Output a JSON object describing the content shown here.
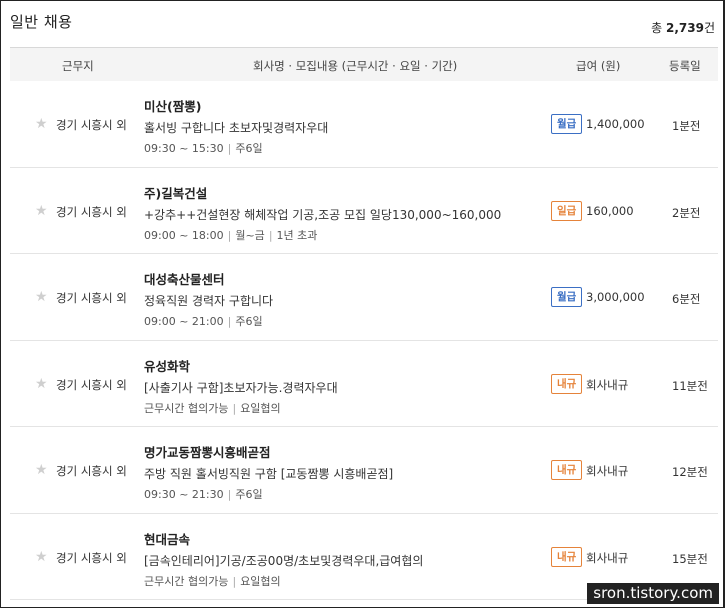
{
  "header": {
    "title": "일반 채용",
    "total_prefix": "총 ",
    "total_count": "2,739",
    "total_suffix": "건"
  },
  "table_header": {
    "location": "근무지",
    "company": "회사명 · 모집내용 (근무시간 · 요일 · 기간)",
    "pay": "급여 (원)",
    "posted": "등록일"
  },
  "rows": [
    {
      "location": "경기 시흥시 외",
      "company": "미산(짬뽕)",
      "desc": "홀서빙 구합니다 초보자및경력자우대",
      "meta": [
        "09:30 ~ 15:30",
        "주6일"
      ],
      "pay_type": "월급",
      "pay_color": "blue",
      "pay": "1,400,000",
      "posted": "1분전"
    },
    {
      "location": "경기 시흥시 외",
      "company": "주)길복건설",
      "desc": "+강추++건설현장 해체작업 기공,조공 모집 일당130,000~160,000",
      "meta": [
        "09:00 ~ 18:00",
        "월~금",
        "1년 초과"
      ],
      "pay_type": "일급",
      "pay_color": "orange",
      "pay": "160,000",
      "posted": "2분전"
    },
    {
      "location": "경기 시흥시 외",
      "company": "대성축산물센터",
      "desc": "정육직원 경력자 구합니다",
      "meta": [
        "09:00 ~ 21:00",
        "주6일"
      ],
      "pay_type": "월급",
      "pay_color": "blue",
      "pay": "3,000,000",
      "posted": "6분전"
    },
    {
      "location": "경기 시흥시 외",
      "company": "유성화학",
      "desc": "[사출기사 구함]초보자가능.경력자우대",
      "meta": [
        "근무시간 협의가능",
        "요일협의"
      ],
      "pay_type": "내규",
      "pay_color": "orange",
      "pay": "회사내규",
      "posted": "11분전"
    },
    {
      "location": "경기 시흥시 외",
      "company": "명가교동짬뽕시흥배곧점",
      "desc": "주방 직원 홀서빙직원 구함 [교동짬뽕 시흥배곧점]",
      "meta": [
        "09:30 ~ 21:30",
        "주6일"
      ],
      "pay_type": "내규",
      "pay_color": "orange",
      "pay": "회사내규",
      "posted": "12분전"
    },
    {
      "location": "경기 시흥시 외",
      "company": "현대금속",
      "desc": "[금속인테리어]기공/조공00명/초보및경력우대,급여협의",
      "meta": [
        "근무시간 협의가능",
        "요일협의"
      ],
      "pay_type": "내규",
      "pay_color": "orange",
      "pay": "회사내규",
      "posted": "15분전"
    }
  ],
  "watermark": "sron.tistory.com",
  "colors": {
    "blue_badge": "#3b6fc4",
    "orange_badge": "#e5833a",
    "header_bg": "#f4f4f4"
  },
  "icons": {
    "favorite": "star-icon"
  }
}
